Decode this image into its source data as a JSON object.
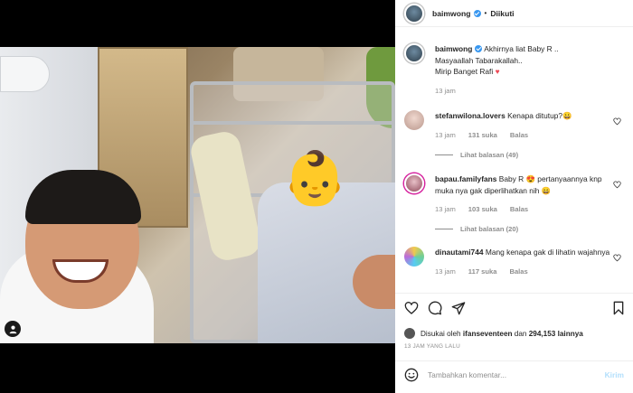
{
  "header": {
    "username": "baimwong",
    "separator": "•",
    "follow_status": "Diikuti"
  },
  "caption": {
    "username": "baimwong",
    "lines": [
      "Akhirnya liat Baby R ..",
      "Masyaallah Tabarakallah..",
      "Mirip Banget Rafi"
    ],
    "heart": "♥",
    "time": "13 jam"
  },
  "comments": [
    {
      "username": "stefanwilona.lovers",
      "text": "Kenapa ditutup?😀",
      "time": "13 jam",
      "likes": "131 suka",
      "reply": "Balas",
      "view_replies": "Lihat balasan (49)"
    },
    {
      "username": "bapau.familyfans",
      "text": "Baby R 😍 pertanyaannya knp muka nya gak diperlihatkan nih 😄",
      "time": "13 jam",
      "likes": "103 suka",
      "reply": "Balas",
      "view_replies": "Lihat balasan (20)"
    },
    {
      "username": "dinautami744",
      "text": "Mang kenapa gak di lihatin wajahnya",
      "time": "13 jam",
      "likes": "117 suka",
      "reply": "Balas"
    }
  ],
  "likes_summary": {
    "prefix": "Disukai oleh",
    "user": "ifanseventeen",
    "middle": "dan",
    "count": "294,153 lainnya"
  },
  "posted_time": "13 JAM YANG LALU",
  "compose": {
    "placeholder": "Tambahkan komentar...",
    "post_label": "Kirim"
  },
  "photo": {
    "sticker": "👶"
  },
  "colors": {
    "accent": "#3897f0",
    "heart": "#ed4956",
    "muted": "#8e8e8e"
  }
}
